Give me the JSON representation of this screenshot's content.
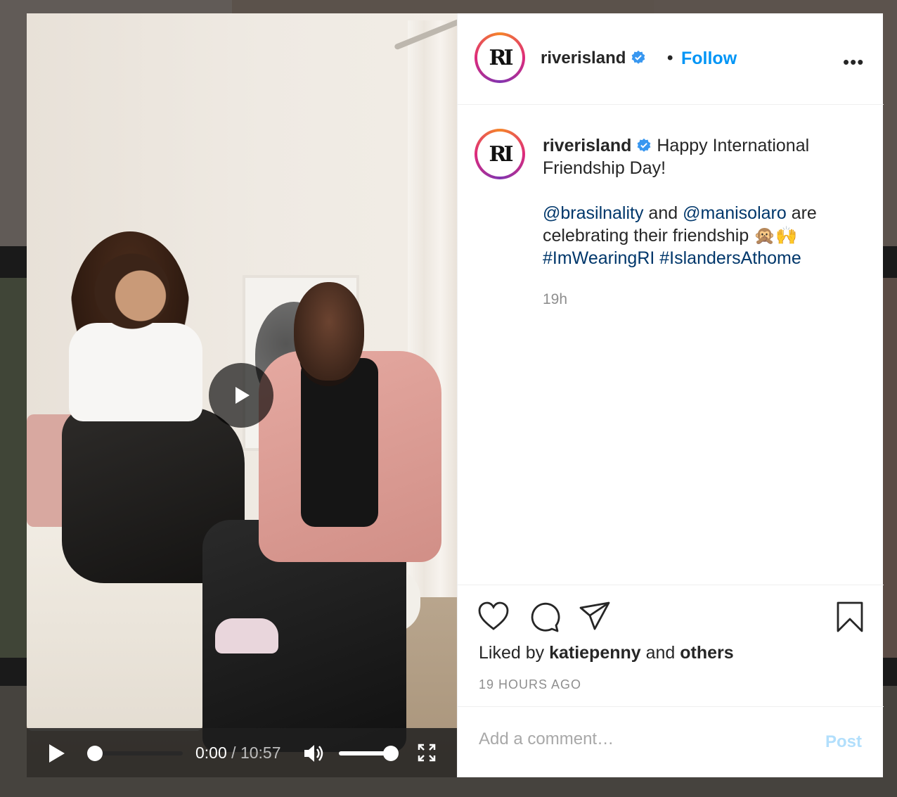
{
  "post": {
    "username": "riverisland",
    "logo_text": "RI",
    "separator": "•",
    "follow_label": "Follow",
    "more_label": "•••",
    "caption_line1": "Happy International Friendship Day!",
    "mention1": "@brasilnality",
    "and1": " and ",
    "mention2": "@manisolaro",
    "caption_rest": " are celebrating their friendship 🙊🙌",
    "hashtag1": "#ImWearingRI",
    "hashtag2": "#IslandersAthome",
    "posted_ago": "19h",
    "liked_prefix": "Liked by ",
    "liked_user": "katiepenny",
    "liked_and": " and ",
    "liked_others": "others",
    "timestamp_full": "19 HOURS AGO",
    "comment_placeholder": "Add a comment…",
    "post_label": "Post"
  },
  "video": {
    "current_time": "0:00",
    "time_separator": " / ",
    "duration": "10:57",
    "progress": 0.0,
    "volume": 1.0
  },
  "colors": {
    "follow_blue": "#0095f6",
    "link_navy": "#00376b",
    "post_disabled": "#b2dffc",
    "verified_blue": "#3897f0"
  }
}
